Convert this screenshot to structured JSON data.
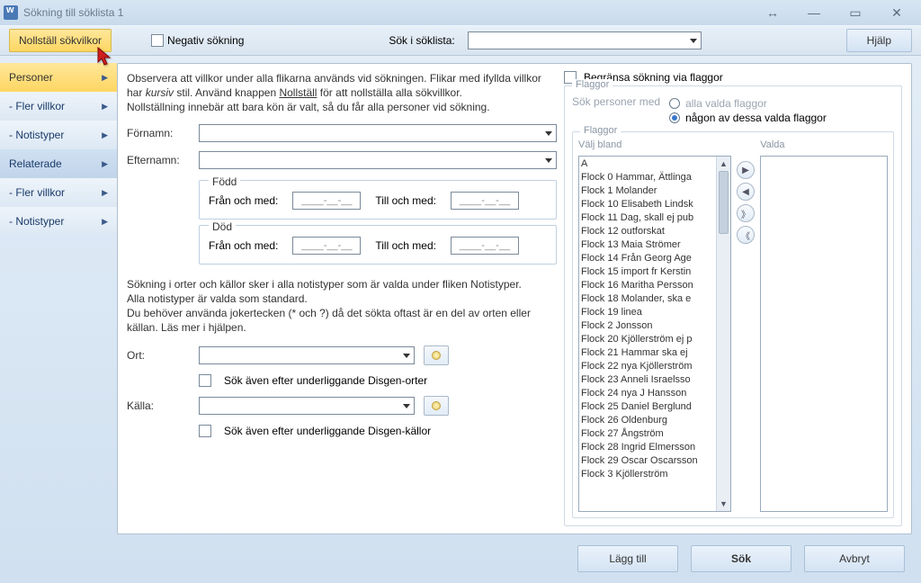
{
  "titlebar": {
    "title": "Sökning till söklista 1"
  },
  "toolbar": {
    "reset_label": "Nollställ sökvilkor",
    "negative_label": "Negativ sökning",
    "search_in_label": "Sök i söklista:",
    "help_label": "Hjälp"
  },
  "sidebar": {
    "items": [
      {
        "label": "Personer"
      },
      {
        "label": "- Fler villkor"
      },
      {
        "label": "- Notistyper"
      },
      {
        "label": "Relaterade"
      },
      {
        "label": "- Fler villkor"
      },
      {
        "label": "- Notistyper"
      }
    ]
  },
  "info": {
    "line1a": "Observera att villkor under alla flikarna används vid sökningen. Flikar med ifyllda villkor har ",
    "line1_italic": "kursiv",
    "line1b": " stil. Använd knappen ",
    "line1_underline": "Nollställ",
    "line1c": " för att nollställa alla sökvillkor.",
    "line2": "Nollställning innebär att bara kön är valt, så du får alla personer vid sökning."
  },
  "form": {
    "firstname_label": "Förnamn:",
    "lastname_label": "Efternamn:",
    "born_legend": "Född",
    "dead_legend": "Död",
    "from_label": "Från och med:",
    "to_label": "Till och med:",
    "date_placeholder": "____-__-__",
    "note1": "Sökning i orter och källor sker i alla notistyper som är valda under fliken Notistyper.",
    "note2": "Alla notistyper är valda som standard.",
    "note3": "Du behöver använda jokertecken (* och ?) då det sökta oftast är en del av orten eller källan. Läs mer i hjälpen.",
    "ort_label": "Ort:",
    "ort_sub_label": "Sök även efter underliggande Disgen-orter",
    "kalla_label": "Källa:",
    "kalla_sub_label": "Sök även efter underliggande Disgen-källor"
  },
  "flags": {
    "restrict_label": "Begränsa sökning via flaggor",
    "group_label": "Flaggor",
    "search_with_label": "Sök personer med",
    "radio_all": "alla valda flaggor",
    "radio_any": "någon av dessa valda flaggor",
    "inner_legend": "Flaggor",
    "left_header": "Välj bland",
    "right_header": "Valda",
    "items": [
      "A",
      "Flock 0 Hammar, Ättlinga",
      "Flock 1 Molander",
      "Flock 10 Elisabeth Lindsk",
      "Flock 11 Dag, skall ej pub",
      "Flock 12 outforskat",
      "Flock 13 Maia Strömer",
      "Flock 14 Från Georg Age",
      "Flock 15 import fr Kerstin",
      "Flock 16 Maritha Persson",
      "Flock 18 Molander, ska e",
      "Flock 19 linea",
      "Flock 2 Jonsson",
      "Flock 20 Kjöllerström ej p",
      "Flock 21 Hammar ska ej",
      "Flock 22 nya Kjöllerström",
      "Flock 23 Anneli Israelsso",
      "Flock 24 nya J Hansson",
      "Flock 25 Daniel Berglund",
      "Flock 26 Oldenburg",
      "Flock 27 Ångström",
      "Flock 28 Ingrid Elmersson",
      "Flock 29 Oscar Oscarsson",
      "Flock 3 Kjöllerström"
    ]
  },
  "footer": {
    "add_label": "Lägg till",
    "search_label": "Sök",
    "cancel_label": "Avbryt"
  }
}
